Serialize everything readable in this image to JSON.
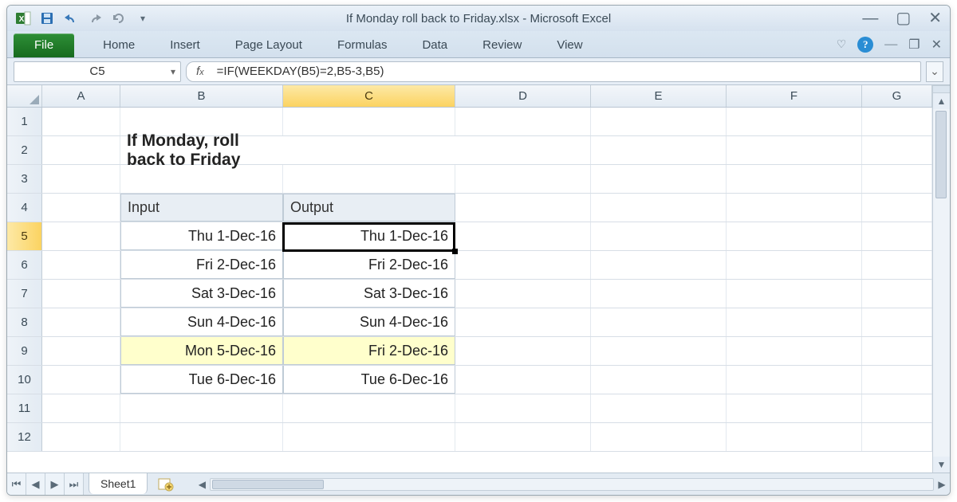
{
  "window": {
    "title": "If Monday roll back to Friday.xlsx  -  Microsoft Excel"
  },
  "tabs": {
    "file": "File",
    "items": [
      "Home",
      "Insert",
      "Page Layout",
      "Formulas",
      "Data",
      "Review",
      "View"
    ]
  },
  "nameBox": "C5",
  "formula": "=IF(WEEKDAY(B5)=2,B5-3,B5)",
  "columns": [
    "A",
    "B",
    "C",
    "D",
    "E",
    "F",
    "G"
  ],
  "rowNumbers": [
    "1",
    "2",
    "3",
    "4",
    "5",
    "6",
    "7",
    "8",
    "9",
    "10",
    "11",
    "12"
  ],
  "content": {
    "title": "If Monday, roll back to Friday",
    "headerInput": "Input",
    "headerOutput": "Output",
    "rows": [
      {
        "input": "Thu 1-Dec-16",
        "output": "Thu 1-Dec-16",
        "hl": false
      },
      {
        "input": "Fri 2-Dec-16",
        "output": "Fri 2-Dec-16",
        "hl": false
      },
      {
        "input": "Sat 3-Dec-16",
        "output": "Sat 3-Dec-16",
        "hl": false
      },
      {
        "input": "Sun 4-Dec-16",
        "output": "Sun 4-Dec-16",
        "hl": false
      },
      {
        "input": "Mon 5-Dec-16",
        "output": "Fri 2-Dec-16",
        "hl": true
      },
      {
        "input": "Tue 6-Dec-16",
        "output": "Tue 6-Dec-16",
        "hl": false
      }
    ]
  },
  "sheetTab": "Sheet1"
}
